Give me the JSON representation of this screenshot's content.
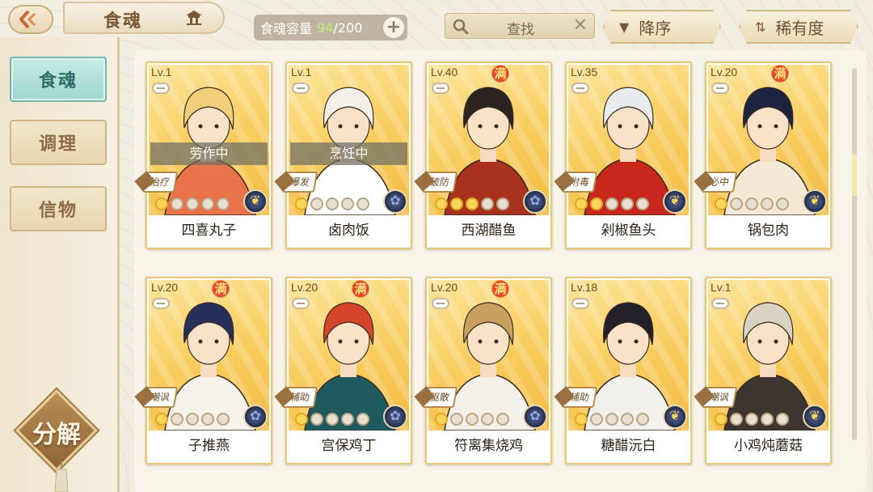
{
  "header": {
    "title": "食魂",
    "capacity_label": "食魂容量",
    "capacity_current": "94",
    "capacity_max": "/200",
    "search_label": "查找",
    "sort_order_label": "降序",
    "sort_rarity_label": "稀有度"
  },
  "sidebar": {
    "items": [
      {
        "label": "食魂",
        "active": true
      },
      {
        "label": "调理",
        "active": false
      },
      {
        "label": "信物",
        "active": false
      }
    ],
    "decompose_label": "分解"
  },
  "cards": [
    {
      "level": "Lv.1",
      "full": "",
      "status": "劳作中",
      "role": "治疗",
      "stars": 1,
      "name": "四喜丸子",
      "emblem": "gold",
      "hair": "#f2cf7a",
      "cloth": "#e9734a"
    },
    {
      "level": "Lv.1",
      "full": "",
      "status": "烹饪中",
      "role": "爆发",
      "stars": 1,
      "name": "卤肉饭",
      "emblem": "blue",
      "hair": "#f4f1ea",
      "cloth": "#ffffff"
    },
    {
      "level": "Lv.40",
      "full": "满",
      "status": "",
      "role": "破防",
      "stars": 3,
      "name": "西湖醋鱼",
      "emblem": "blue",
      "hair": "#2b2420",
      "cloth": "#a8321e"
    },
    {
      "level": "Lv.35",
      "full": "",
      "status": "",
      "role": "附毒",
      "stars": 2,
      "name": "剁椒鱼头",
      "emblem": "gold",
      "hair": "#e9ecef",
      "cloth": "#c8281c"
    },
    {
      "level": "Lv.20",
      "full": "满",
      "status": "",
      "role": "必中",
      "stars": 1,
      "name": "锅包肉",
      "emblem": "gold",
      "hair": "#1e2340",
      "cloth": "#f4e9d4"
    },
    {
      "level": "Lv.20",
      "full": "满",
      "status": "",
      "role": "嘲讽",
      "stars": 1,
      "name": "子推燕",
      "emblem": "blue",
      "hair": "#27305a",
      "cloth": "#f6f3ec"
    },
    {
      "level": "Lv.20",
      "full": "满",
      "status": "",
      "role": "辅助",
      "stars": 1,
      "name": "宫保鸡丁",
      "emblem": "blue",
      "hair": "#d4452a",
      "cloth": "#1f5a5e"
    },
    {
      "level": "Lv.20",
      "full": "满",
      "status": "",
      "role": "驱散",
      "stars": 1,
      "name": "符离集烧鸡",
      "emblem": "blue",
      "hair": "#caa060",
      "cloth": "#f4f1ea"
    },
    {
      "level": "Lv.18",
      "full": "",
      "status": "",
      "role": "辅助",
      "stars": 1,
      "name": "糖醋沅白",
      "emblem": "gold",
      "hair": "#23202a",
      "cloth": "#f3f1ec"
    },
    {
      "level": "Lv.1",
      "full": "",
      "status": "",
      "role": "嘲讽",
      "stars": 1,
      "name": "小鸡炖蘑菇",
      "emblem": "gold",
      "hair": "#d9d3c4",
      "cloth": "#3c3530"
    }
  ]
}
